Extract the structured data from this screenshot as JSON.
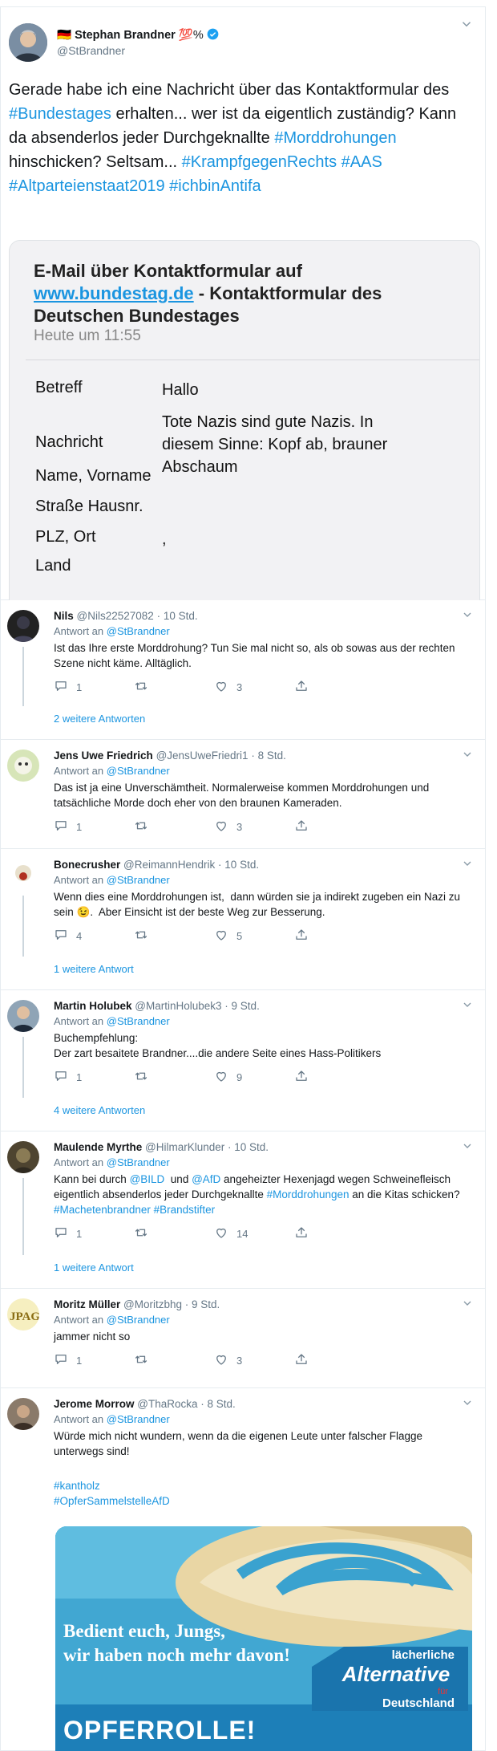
{
  "main_tweet": {
    "flag": "🇩🇪",
    "name": "Stephan Brandner",
    "emoji": "💯",
    "percent": "%",
    "handle": "@StBrandner",
    "text_parts": [
      {
        "t": "Gerade habe ich eine Nachricht über das Kontaktformular des ",
        "link": false
      },
      {
        "t": "#Bundestages",
        "link": true
      },
      {
        "t": " erhalten... wer ist da eigentlich zuständig? Kann da absenderlos jeder Durchgeknallte ",
        "link": false
      },
      {
        "t": "#Morddrohungen",
        "link": true
      },
      {
        "t": " hinschicken? Seltsam... ",
        "link": false
      },
      {
        "t": "#KrampfgegenRechts",
        "link": true
      },
      {
        "t": " ",
        "link": false
      },
      {
        "t": "#AAS",
        "link": true
      },
      {
        "t": " ",
        "link": false
      },
      {
        "t": "#Altparteienstaat2019",
        "link": true
      },
      {
        "t": " ",
        "link": false
      },
      {
        "t": "#ichbinAntifa",
        "link": true
      }
    ],
    "email": {
      "title_a": "E-Mail über Kontaktformular auf",
      "title_link": "www.bundestag.de",
      "title_b": " -   Kontaktformular des Deutschen Bundestages",
      "time": "Heute um 11:55",
      "rows": [
        {
          "label": "Betreff",
          "value": "Hallo"
        },
        {
          "label": "Nachricht",
          "value": "Tote Nazis sind gute Nazis. In diesem Sinne: Kopf ab, brauner Abschaum"
        },
        {
          "label": "Name, Vorname",
          "value": ""
        },
        {
          "label": "Straße Hausnr.",
          "value": ""
        },
        {
          "label": "PLZ, Ort",
          "value": ","
        },
        {
          "label": "Land",
          "value": ""
        }
      ]
    }
  },
  "replying_to_prefix": "Antwort an ",
  "reply_to_handle": "@StBrandner",
  "replies": [
    {
      "name": "Nils",
      "handle": "@Nils22527082",
      "time": "10 Std.",
      "body": "Ist das Ihre erste Morddrohung? Tun Sie mal nicht so, als ob sowas aus der rechten Szene nicht käme. Alltäglich.",
      "replies_count": "1",
      "retweets": "",
      "likes": "3",
      "more": "2 weitere Antworten"
    },
    {
      "name": "Jens Uwe Friedrich",
      "handle": "@JensUweFriedri1",
      "time": "8 Std.",
      "body": "Das ist ja eine Unverschämtheit. Normalerweise kommen Morddrohungen und tatsächliche Morde doch eher von den braunen Kameraden.",
      "replies_count": "1",
      "retweets": "",
      "likes": "3",
      "more": ""
    },
    {
      "name": "Bonecrusher",
      "handle": "@ReimannHendrik",
      "time": "10 Std.",
      "body": "Wenn dies eine Morddrohungen ist,  dann würden sie ja indirekt zugeben ein Nazi zu sein 😉.  Aber Einsicht ist der beste Weg zur Besserung.",
      "replies_count": "4",
      "retweets": "",
      "likes": "5",
      "more": "1 weitere Antwort"
    },
    {
      "name": "Martin Holubek",
      "handle": "@MartinHolubek3",
      "time": "9 Std.",
      "body": "Buchempfehlung:\nDer zart besaitete Brandner....die andere Seite eines Hass-Politikers",
      "replies_count": "1",
      "retweets": "",
      "likes": "9",
      "more": "4 weitere Antworten"
    },
    {
      "name": "Maulende Myrthe",
      "handle": "@HilmarKlunder",
      "time": "10 Std.",
      "body_parts": [
        {
          "t": "Kann bei durch ",
          "link": false
        },
        {
          "t": "@BILD",
          "link": true
        },
        {
          "t": "  und ",
          "link": false
        },
        {
          "t": "@AfD",
          "link": true
        },
        {
          "t": " angeheizter Hexenjagd wegen Schweinefleisch eigentlich absenderlos jeder Durchgeknallte ",
          "link": false
        },
        {
          "t": "#Morddrohungen",
          "link": true
        },
        {
          "t": " an die Kitas schicken? ",
          "link": false
        },
        {
          "t": "#Machetenbrandner",
          "link": true
        },
        {
          "t": " ",
          "link": false
        },
        {
          "t": "#Brandstifter",
          "link": true
        }
      ],
      "replies_count": "1",
      "retweets": "",
      "likes": "14",
      "more": "1 weitere Antwort"
    },
    {
      "name": "Moritz Müller",
      "handle": "@Moritzbhg",
      "time": "9 Std.",
      "body": "jammer nicht so",
      "replies_count": "1",
      "retweets": "",
      "likes": "3",
      "more": ""
    },
    {
      "name": "Jerome Morrow",
      "handle": "@ThaRocka",
      "time": "8 Std.",
      "body": "Würde mich nicht wundern, wenn da die eigenen Leute unter falscher Flagge unterwegs sind!",
      "tags": [
        "#kantholz",
        "#OpferSammelstelleAfD"
      ],
      "image": {
        "line1": "Bedient euch, Jungs,",
        "line2": "wir haben noch mehr davon!",
        "bottom": "OPFERROLLE!",
        "logo_top": "lächerliche",
        "logo_main": "Alternative",
        "logo_sub": "für",
        "logo_sub2": "Deutschland"
      }
    }
  ],
  "colors": {
    "link": "#1b95e0",
    "muted": "#657786",
    "border": "#e6ecf0"
  }
}
